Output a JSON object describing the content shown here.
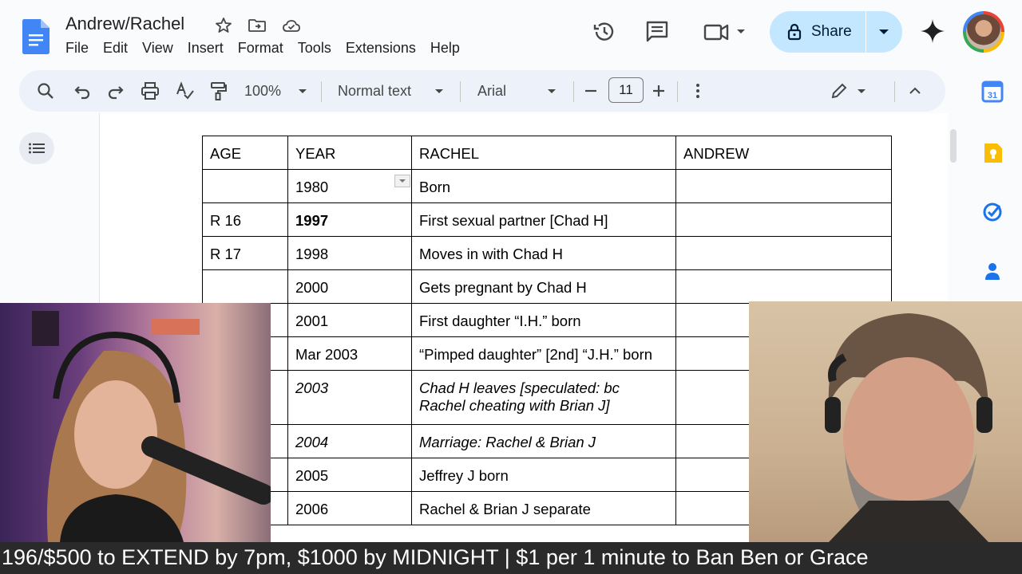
{
  "header": {
    "title": "Andrew/Rachel",
    "menu": [
      "File",
      "Edit",
      "View",
      "Insert",
      "Format",
      "Tools",
      "Extensions",
      "Help"
    ],
    "share_label": "Share"
  },
  "toolbar": {
    "zoom": "100%",
    "style": "Normal text",
    "font": "Arial",
    "font_size": "11"
  },
  "table": {
    "headers": [
      "AGE",
      "YEAR",
      "RACHEL",
      "ANDREW"
    ],
    "rows": [
      {
        "age": "",
        "year": "1980",
        "rachel": "Born",
        "andrew": ""
      },
      {
        "age": "R 16",
        "year": "1997",
        "rachel": "First sexual partner [Chad H]",
        "andrew": ""
      },
      {
        "age": "R 17",
        "year": "1998",
        "rachel": "Moves in with Chad H",
        "andrew": ""
      },
      {
        "age": "",
        "year": "2000",
        "rachel": "Gets pregnant by Chad H",
        "andrew": ""
      },
      {
        "age": "",
        "year": "2001",
        "rachel": "First daughter “I.H.” born",
        "andrew": ""
      },
      {
        "age": "",
        "year": "Mar 2003",
        "rachel": "“Pimped daughter” [2nd] “J.H.” born",
        "andrew": ""
      },
      {
        "age": "",
        "year": "2003",
        "rachel": "Chad H leaves [speculated: bc Rachel cheating with Brian J]",
        "andrew": ""
      },
      {
        "age": "",
        "year": "2004",
        "rachel": "Marriage: Rachel & Brian J",
        "andrew": ""
      },
      {
        "age": "",
        "year": "2005",
        "rachel": "Jeffrey J born",
        "andrew": ""
      },
      {
        "age": "",
        "year": "2006",
        "rachel": "Rachel & Brian J separate",
        "andrew": ""
      }
    ]
  },
  "banner": {
    "text": "196/$500 to EXTEND by 7pm, $1000 by MIDNIGHT | $1 per 1 minute to Ban Ben or Grace"
  },
  "colors": {
    "share_bg": "#c2e7ff",
    "toolbar_bg": "#edf2fa",
    "docs_blue": "#4285f4",
    "app_bg": "#f9fbfd"
  }
}
